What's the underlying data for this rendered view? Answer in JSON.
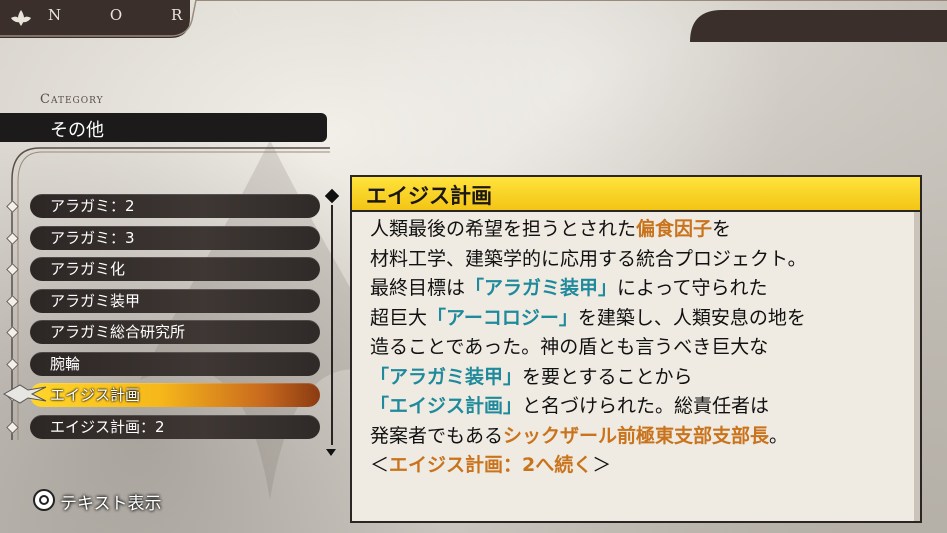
{
  "header": {
    "title": "N O R N"
  },
  "category": {
    "label": "Category",
    "value": "その他"
  },
  "list": {
    "items": [
      {
        "label": "アラガミ：2"
      },
      {
        "label": "アラガミ：3"
      },
      {
        "label": "アラガミ化"
      },
      {
        "label": "アラガミ装甲"
      },
      {
        "label": "アラガミ総合研究所"
      },
      {
        "label": "腕輪"
      },
      {
        "label": "エイジス計画",
        "selected": true
      },
      {
        "label": "エイジス計画：2"
      }
    ]
  },
  "detail": {
    "title": "エイジス計画",
    "lines": [
      [
        {
          "t": "人類最後の希望を担うとされた"
        },
        {
          "t": "偏食因子",
          "c": "orange"
        },
        {
          "t": "を"
        }
      ],
      [
        {
          "t": "材料工学、建築学的に応用する統合プロジェクト。"
        }
      ],
      [
        {
          "t": "最終目標は"
        },
        {
          "t": "「アラガミ装甲」",
          "c": "teal"
        },
        {
          "t": "によって守られた"
        }
      ],
      [
        {
          "t": "超巨大"
        },
        {
          "t": "「アーコロジー」",
          "c": "teal"
        },
        {
          "t": "を建築し、人類安息の地を"
        }
      ],
      [
        {
          "t": "造ることであった。神の盾とも言うべき巨大な"
        }
      ],
      [
        {
          "t": "「アラガミ装甲」",
          "c": "teal"
        },
        {
          "t": "を要とすることから"
        }
      ],
      [
        {
          "t": "「エイジス計画」",
          "c": "teal"
        },
        {
          "t": "と名づけられた。総責任者は"
        }
      ],
      [
        {
          "t": "発案者でもある"
        },
        {
          "t": "シックザール前極東支部支部長",
          "c": "orange"
        },
        {
          "t": "。"
        }
      ],
      [
        {
          "t": "＜"
        },
        {
          "t": "エイジス計画：2へ続く",
          "c": "orange"
        },
        {
          "t": "＞"
        }
      ]
    ]
  },
  "footer": {
    "button_icon": "circle-button-icon",
    "prompt": "テキスト表示"
  },
  "colors": {
    "accent": "#f3c515",
    "orange": "#c9731c",
    "teal": "#1f8a9c",
    "dark": "#2b2624"
  }
}
